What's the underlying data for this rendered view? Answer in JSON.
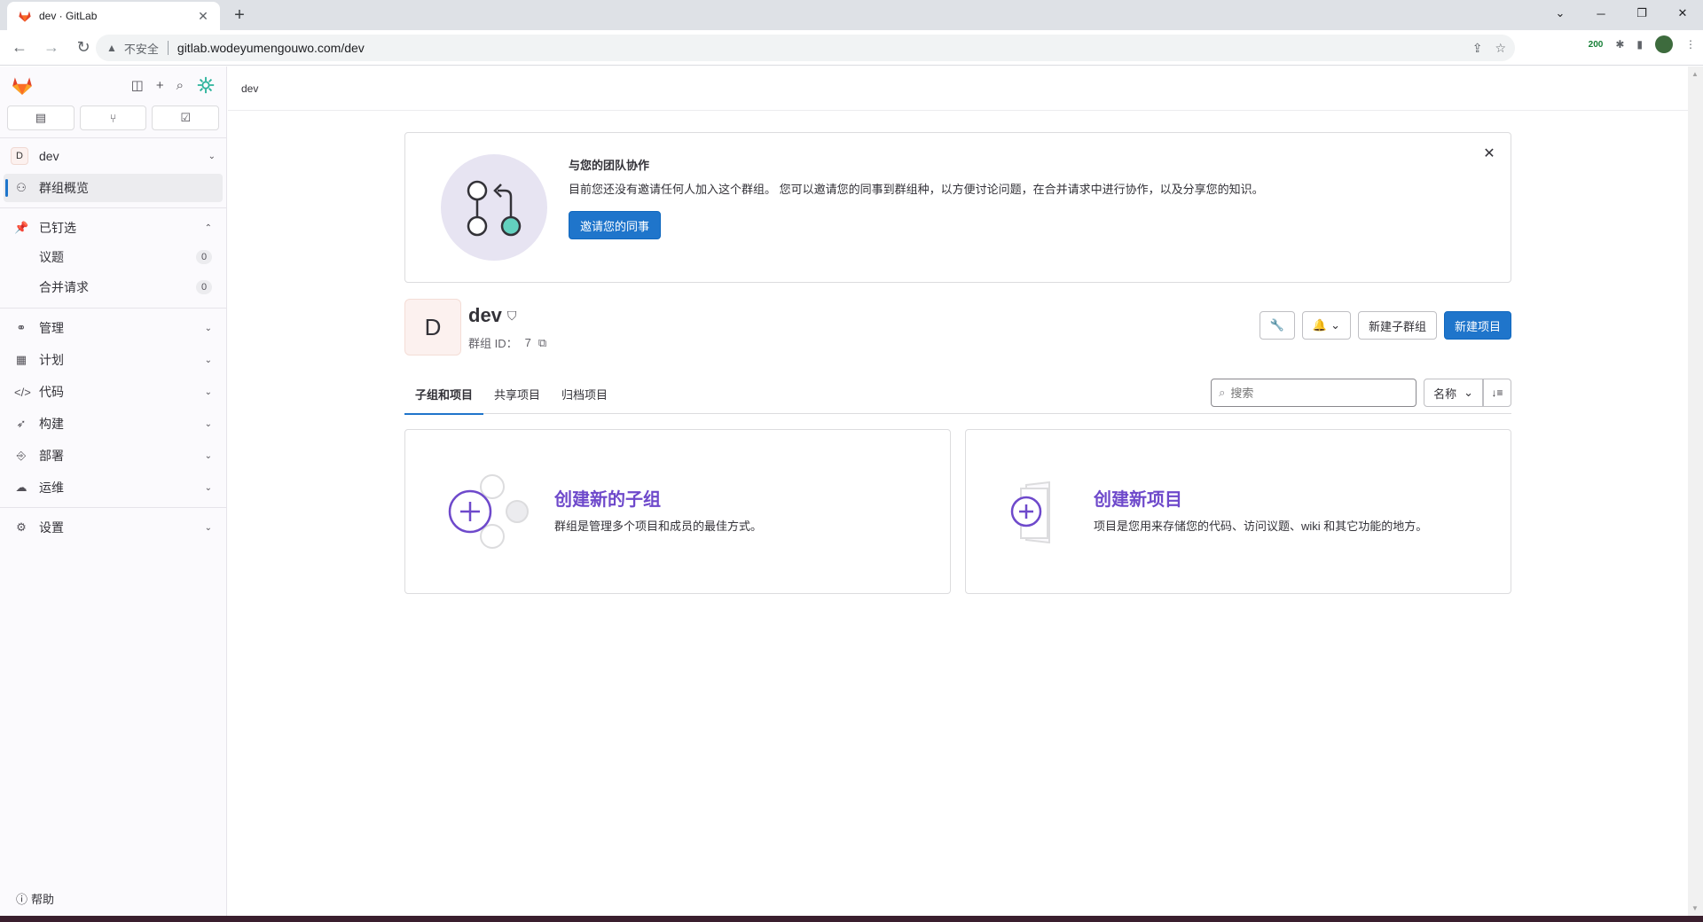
{
  "browser": {
    "tab_title": "dev · GitLab",
    "insecure_label": "不安全",
    "url": "gitlab.wodeyumengouwo.com/dev",
    "ext_badge": "200"
  },
  "sidebar": {
    "context_name": "dev",
    "context_avatar": "D",
    "overview": "群组概览",
    "pinned": {
      "label": "已钉选",
      "items": [
        {
          "label": "议题",
          "count": "0"
        },
        {
          "label": "合并请求",
          "count": "0"
        }
      ]
    },
    "sections": [
      "管理",
      "计划",
      "代码",
      "构建",
      "部署",
      "运维"
    ],
    "settings": "设置",
    "help": "帮助"
  },
  "breadcrumb": "dev",
  "invite": {
    "title": "与您的团队协作",
    "description": "目前您还没有邀请任何人加入这个群组。 您可以邀请您的同事到群组种，以方便讨论问题，在合并请求中进行协作，以及分享您的知识。",
    "button": "邀请您的同事"
  },
  "group": {
    "avatar": "D",
    "name": "dev",
    "id_label": "群组 ID：",
    "id_value": "7",
    "new_subgroup": "新建子群组",
    "new_project": "新建项目"
  },
  "tabs": [
    {
      "label": "子组和项目",
      "active": true
    },
    {
      "label": "共享项目",
      "active": false
    },
    {
      "label": "归档项目",
      "active": false
    }
  ],
  "filter": {
    "search_placeholder": "搜索",
    "sort_label": "名称"
  },
  "empty_cards": {
    "subgroup": {
      "title": "创建新的子组",
      "description": "群组是管理多个项目和成员的最佳方式。"
    },
    "project": {
      "title": "创建新项目",
      "description": "项目是您用来存储您的代码、访问议题、wiki 和其它功能的地方。"
    }
  },
  "colors": {
    "primary": "#1f75cb",
    "accent_purple": "#6e49cb",
    "sidebar_bg": "#fbfafd"
  }
}
